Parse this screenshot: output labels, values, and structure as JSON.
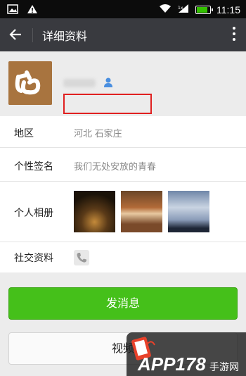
{
  "status_bar": {
    "time": "11:15",
    "battery_level": 0.85,
    "icons": [
      "image-icon",
      "warning-icon",
      "wifi-icon",
      "signal-icon",
      "battery-icon"
    ]
  },
  "header": {
    "title": "详细资料"
  },
  "profile": {
    "nickname": ""
  },
  "details": {
    "region_label": "地区",
    "region_value": "河北  石家庄",
    "signature_label": "个性签名",
    "signature_value": "我们无处安放的青春",
    "album_label": "个人相册",
    "social_label": "社交资料"
  },
  "actions": {
    "send_message": "发消息",
    "video_call": "视频"
  },
  "watermark": {
    "text": "APP178",
    "suffix": "手游网"
  },
  "colors": {
    "status_bar_bg": "#0c0c0c",
    "title_bar_bg": "#393a3f",
    "primary_green": "#45c01a",
    "highlight_red": "#e02020",
    "battery_green": "#33c000"
  }
}
